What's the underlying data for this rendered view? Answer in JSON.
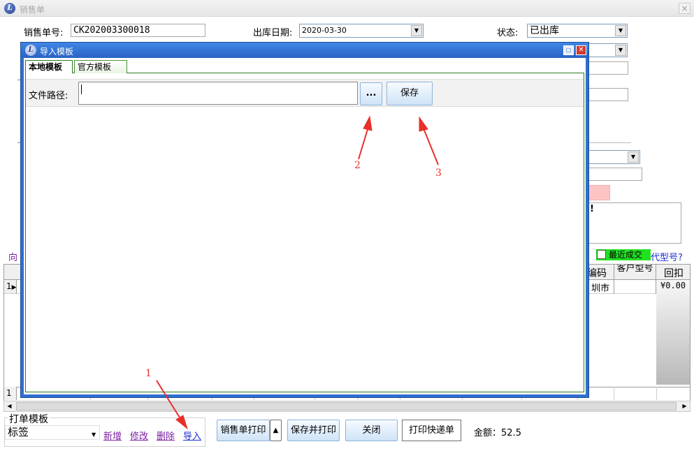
{
  "main_window": {
    "title": "销售单",
    "icon": "app-logo-icon",
    "close_label": "×"
  },
  "header": {
    "order_no_label": "销售单号:",
    "order_no_value": "CK202003300018",
    "date_label": "出库日期:",
    "date_value": "2020-03-30",
    "status_label": "状态:",
    "status_value": "已出库"
  },
  "background_fragments": {
    "left_link_char": "向",
    "remark_text": "!",
    "recent_deals_label": "最近成交",
    "alt_model_label": "代型号?"
  },
  "grid": {
    "columns": [
      "编码",
      "客户型号",
      "回扣"
    ],
    "row_indicator": "1",
    "row_cells": [
      "圳市",
      "",
      "¥0.00"
    ],
    "footer_row_indicator": "1"
  },
  "bottom": {
    "template_group_label": "打单模板",
    "template_value": "标签",
    "link_new": "新增",
    "link_edit": "修改",
    "link_delete": "删除",
    "link_import": "导入",
    "print_sales_btn": "销售单打印",
    "save_print_btn": "保存并打印",
    "close_btn": "关闭",
    "print_express_btn": "打印快递单",
    "amount_label": "金额：",
    "amount_value": "52.5"
  },
  "dialog": {
    "title": "导入模板",
    "tabs": [
      {
        "label": "本地模板",
        "active": true
      },
      {
        "label": "官方模板",
        "active": false
      }
    ],
    "file_path_label": "文件路径:",
    "file_path_value": "",
    "browse_label": "...",
    "save_label": "保存"
  },
  "annotations": {
    "one": "1",
    "two": "2",
    "three": "3",
    "color": "#e8302a"
  }
}
